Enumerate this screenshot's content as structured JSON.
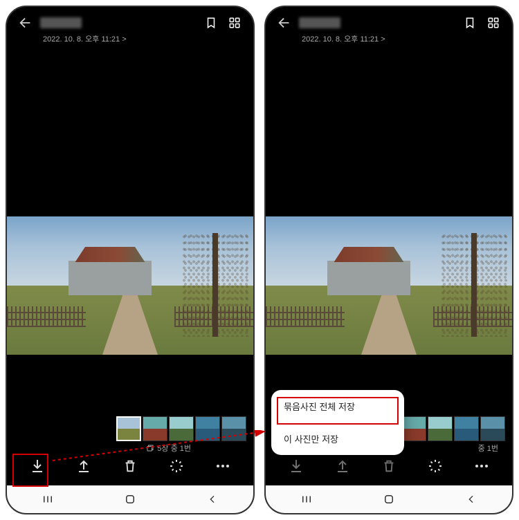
{
  "timestamp": "2022. 10. 8. 오후 11:21 >",
  "strip_caption": "5장 중 1번",
  "strip_caption_right": "중 1번",
  "popup": {
    "save_all": "묶음사진 전체 저장",
    "save_this": "이 사진만 저장"
  },
  "icons": {
    "back": "back-arrow",
    "bookmark": "bookmark-icon",
    "grid": "grid-icon",
    "download": "download-icon",
    "share": "share-icon",
    "trash": "trash-icon",
    "edit": "edit-icon",
    "more": "more-icon",
    "badge": "burst-badge-icon"
  }
}
